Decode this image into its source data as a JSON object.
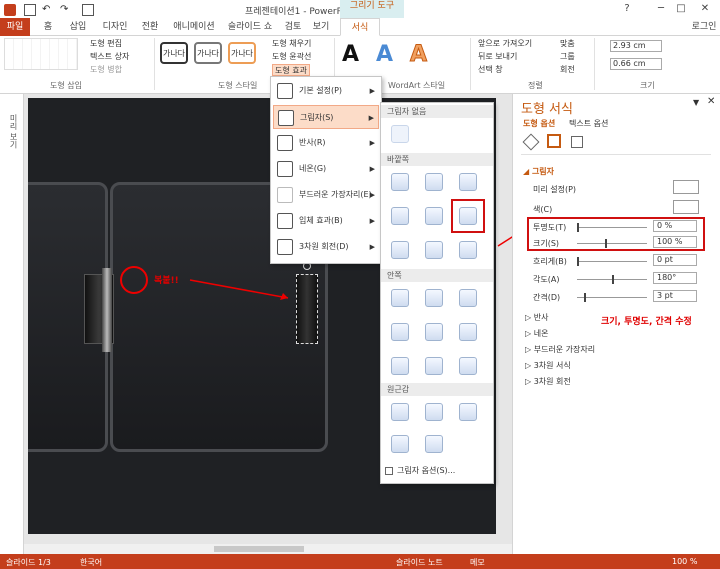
{
  "window": {
    "title": "프레젠테이션1 - PowerPoint",
    "context_group": "그리기 도구",
    "user": "로그인"
  },
  "tabs": [
    {
      "label": "파일"
    },
    {
      "label": "홈"
    },
    {
      "label": "삽입"
    },
    {
      "label": "디자인"
    },
    {
      "label": "전환"
    },
    {
      "label": "애니메이션"
    },
    {
      "label": "슬라이드 쇼"
    },
    {
      "label": "검토"
    },
    {
      "label": "보기"
    },
    {
      "label": "서식"
    }
  ],
  "ribbon": {
    "insert_shapes": {
      "label": "도형 삽입",
      "edit_shape": "도형 편집",
      "text_box": "텍스트 상자",
      "merge_shapes": "도형 병합"
    },
    "shape_styles": {
      "label": "도형 스타일",
      "preset": "가나다",
      "fill": "도형 채우기",
      "outline": "도형 윤곽선",
      "effects": "도형 효과"
    },
    "wordart": {
      "label": "WordArt 스타일",
      "letter": "A"
    },
    "arrange": {
      "label": "정렬",
      "bring_forward": "앞으로 가져오기",
      "send_backward": "뒤로 보내기",
      "selection_pane": "선택 창",
      "align": "맞춤",
      "group": "그룹",
      "rotate": "회전"
    },
    "size": {
      "label": "크기",
      "height": "2.93 cm",
      "width": "0.66 cm"
    }
  },
  "left_strip": {
    "label": "미리 보기"
  },
  "effects_menu": {
    "items": [
      {
        "label": "기본 설정(P)"
      },
      {
        "label": "그림자(S)"
      },
      {
        "label": "반사(R)"
      },
      {
        "label": "네온(G)"
      },
      {
        "label": "부드러운 가장자리(E)"
      },
      {
        "label": "입체 효과(B)"
      },
      {
        "label": "3차원 회전(D)"
      }
    ]
  },
  "shadow_gallery": {
    "no_shadow": "그림자 없음",
    "outer": "바깥쪽",
    "inner": "안쪽",
    "perspective": "원근감",
    "options": "그림자 옵션(S)..."
  },
  "annotations": {
    "copy_label": "복붙!!",
    "edit_note": "크기, 투명도, 간격 수정"
  },
  "format_pane": {
    "title": "도형 서식",
    "tab_shape": "도형 옵션",
    "tab_text": "텍스트 옵션",
    "section": "그림자",
    "rows": {
      "preset": "미리 설정(P)",
      "color": "색(C)",
      "transparency": {
        "label": "투명도(T)",
        "value": "0 %",
        "level": 0
      },
      "size": {
        "label": "크기(S)",
        "value": "100 %",
        "level": 100
      },
      "blur": {
        "label": "흐리게(B)",
        "value": "0 pt"
      },
      "angle": {
        "label": "각도(A)",
        "value": "180°"
      },
      "distance": {
        "label": "간격(D)",
        "value": "3 pt"
      }
    },
    "collapsed": [
      "반사",
      "네온",
      "부드러운 가장자리",
      "3차원 서식",
      "3차원 회전"
    ]
  },
  "status_bar": {
    "slide": "슬라이드 1/3",
    "language": "한국어",
    "notes": "슬라이드 노트",
    "comments": "메모",
    "zoom": "100 %"
  }
}
